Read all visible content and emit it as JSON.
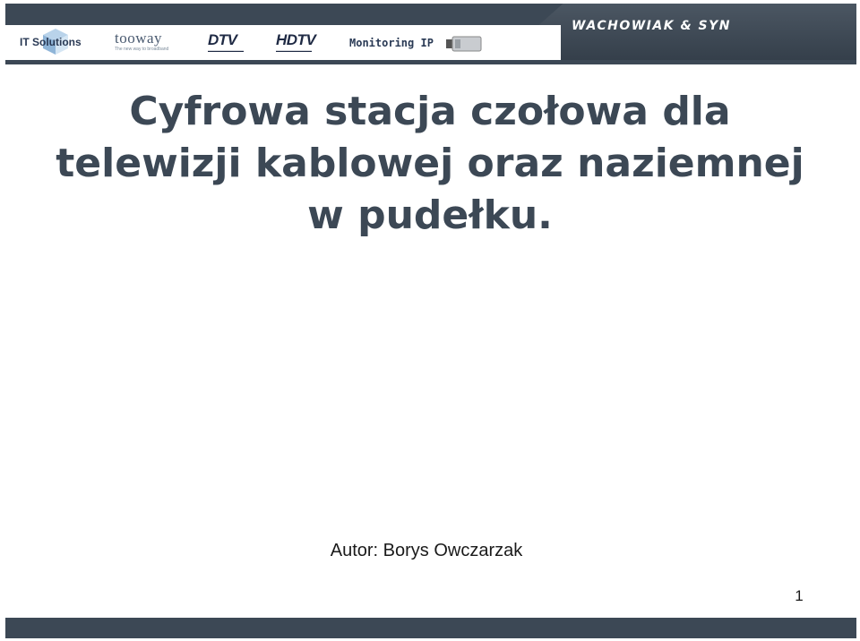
{
  "header": {
    "logos": {
      "it_solutions": "IT Solutions",
      "tooway": "tooway",
      "tooway_tagline": "The new way to broadband",
      "dtv": "DTV",
      "hdtv": "HDTV",
      "monitoring": "Monitoring IP"
    },
    "brand": "WACHOWIAK & SYN",
    "colors": {
      "band": "#3c4855"
    }
  },
  "slide": {
    "title_lines": [
      "Cyfrowa stacja czołowa dla",
      "telewizji kablowej oraz naziemnej",
      "w pudełku."
    ],
    "author": "Autor: Borys Owczarzak",
    "page_number": "1",
    "title_color": "#3c4855"
  }
}
